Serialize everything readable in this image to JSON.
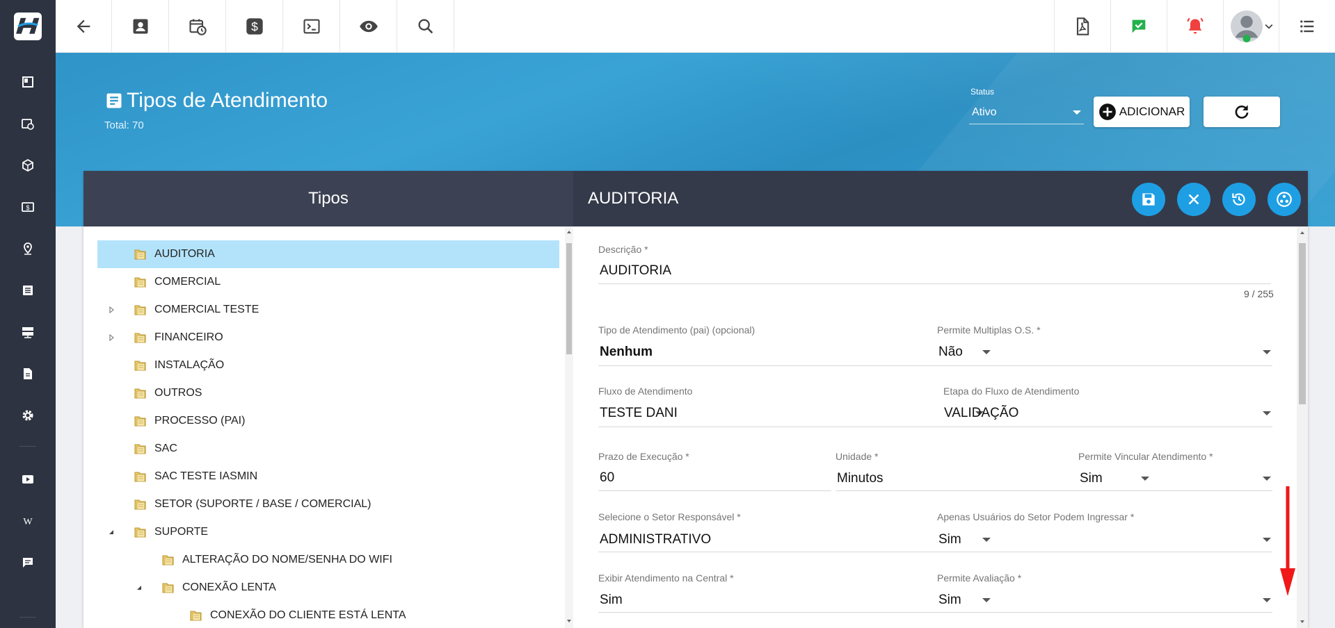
{
  "topbar": {
    "left_icons": [
      "back-arrow-icon",
      "contact-card-icon",
      "calendar-clock-icon",
      "dollar-icon",
      "terminal-icon",
      "eye-icon",
      "search-icon"
    ],
    "right_icons": [
      "pdf-icon",
      "check-icon",
      "alarm-bell-icon",
      "user-avatar",
      "list-menu-icon"
    ]
  },
  "sidebar": {
    "icons": [
      "dashboard-icon",
      "calendar-clock-icon",
      "box-icon",
      "money-icon",
      "location-pin-icon",
      "document-list-icon",
      "server-icon",
      "file-text-icon",
      "gear-icon",
      "play-icon",
      "wikipedia-icon",
      "chat-icon"
    ]
  },
  "header": {
    "title": "Tipos de Atendimento",
    "total": "Total: 70",
    "status_label": "Status",
    "status_value": "Ativo",
    "add_label": "ADICIONAR"
  },
  "left_panel": {
    "title": "Tipos",
    "items": [
      {
        "label": "AUDITORIA",
        "level": 0,
        "expander": "none",
        "selected": true
      },
      {
        "label": "COMERCIAL",
        "level": 0,
        "expander": "none"
      },
      {
        "label": "COMERCIAL TESTE",
        "level": 0,
        "expander": "collapsed"
      },
      {
        "label": "FINANCEIRO",
        "level": 0,
        "expander": "collapsed"
      },
      {
        "label": "INSTALAÇÃO",
        "level": 0,
        "expander": "none"
      },
      {
        "label": "OUTROS",
        "level": 0,
        "expander": "none"
      },
      {
        "label": "PROCESSO (PAI)",
        "level": 0,
        "expander": "none"
      },
      {
        "label": "SAC",
        "level": 0,
        "expander": "none"
      },
      {
        "label": "SAC TESTE IASMIN",
        "level": 0,
        "expander": "none"
      },
      {
        "label": "SETOR (SUPORTE / BASE / COMERCIAL)",
        "level": 0,
        "expander": "none"
      },
      {
        "label": "SUPORTE",
        "level": 0,
        "expander": "expanded"
      },
      {
        "label": "ALTERAÇÃO DO NOME/SENHA DO WIFI",
        "level": 1,
        "expander": "none"
      },
      {
        "label": "CONEXÃO LENTA",
        "level": 1,
        "expander": "expanded"
      },
      {
        "label": "CONEXÃO DO CLIENTE ESTÁ LENTA",
        "level": 2,
        "expander": "none"
      }
    ]
  },
  "form": {
    "title": "AUDITORIA",
    "descricao": {
      "label": "Descrição",
      "value": "AUDITORIA",
      "counter": "9 / 255"
    },
    "tipo_pai": {
      "label": "Tipo de Atendimento (pai) (opcional)",
      "value": "Nenhum"
    },
    "multiplas_os": {
      "label": "Permite Multiplas O.S.",
      "value": "Não"
    },
    "fluxo": {
      "label": "Fluxo de Atendimento",
      "value": "TESTE DANI"
    },
    "etapa": {
      "label": "Etapa do Fluxo de Atendimento",
      "value": "VALIDAÇÃO"
    },
    "prazo": {
      "label": "Prazo de Execução",
      "value": "60"
    },
    "unidade": {
      "label": "Unidade",
      "value": "Minutos"
    },
    "vincular": {
      "label": "Permite Vincular Atendimento",
      "value": "Sim"
    },
    "setor": {
      "label": "Selecione o Setor Responsável",
      "value": "ADMINISTRATIVO"
    },
    "apenas_setor": {
      "label": "Apenas Usuários do Setor Podem Ingressar",
      "value": "Sim"
    },
    "exibir_central": {
      "label": "Exibir Atendimento na Central",
      "value": "Sim"
    },
    "avaliacao": {
      "label": "Permite Avaliação",
      "value": "Sim"
    },
    "required_mark": "*"
  },
  "colors": {
    "sidebar": "#2d3340",
    "banner": "#2f94c7",
    "card_head": "#343a4a",
    "action_button": "#1e9fe4",
    "selected_row": "#b3e3fb"
  }
}
